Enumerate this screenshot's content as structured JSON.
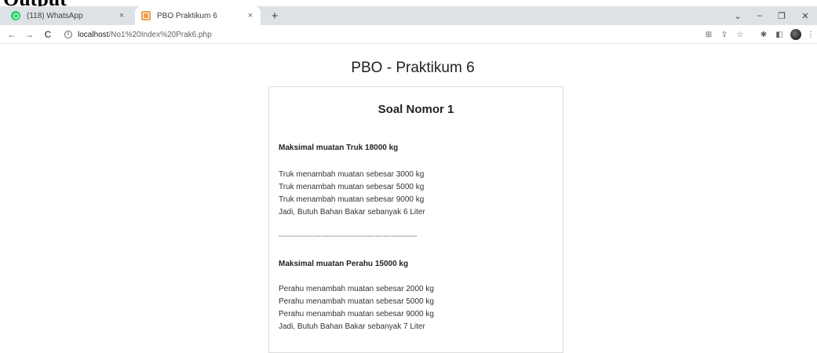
{
  "doc_heading": "Output",
  "browser": {
    "tabs": [
      {
        "title": "(118) WhatsApp",
        "favicon": "whatsapp-icon",
        "active": false
      },
      {
        "title": "PBO Praktikum 6",
        "favicon": "page-icon",
        "active": true
      }
    ],
    "new_tab": "+",
    "close_glyph": "×",
    "window_controls": {
      "chevron": "⌄",
      "minimize": "–",
      "maximize": "❐",
      "close": "✕"
    },
    "nav": {
      "back": "←",
      "forward": "→",
      "reload": "C"
    },
    "url": {
      "info": "i",
      "host": "localhost",
      "path": "/No1%20Index%20Prak6.php"
    },
    "toolbar_icons": {
      "translate": "⊞",
      "share": "⇪",
      "bookmark": "☆",
      "extensions": "✱",
      "sidepanel": "◧",
      "menu": "⋮"
    }
  },
  "page": {
    "title": "PBO - Praktikum 6",
    "card_title": "Soal Nomor 1",
    "truk": {
      "heading": "Maksimal muatan Truk 18000 kg",
      "lines": [
        "Truk menambah muatan sebesar 3000 kg",
        "Truk menambah muatan sebesar 5000 kg",
        "Truk menambah muatan sebesar 9000 kg",
        "Jadi, Butuh Bahan Bakar sebanyak 6 Liter"
      ]
    },
    "separator": "-----------------------------------------------------",
    "perahu": {
      "heading": "Maksimal muatan Perahu 15000 kg",
      "lines": [
        "Perahu menambah muatan sebesar 2000 kg",
        "Perahu menambah muatan sebesar 5000 kg",
        "Perahu menambah muatan sebesar 9000 kg",
        "Jadi, Butuh Bahan Bakar sebanyak 7 Liter"
      ]
    }
  }
}
